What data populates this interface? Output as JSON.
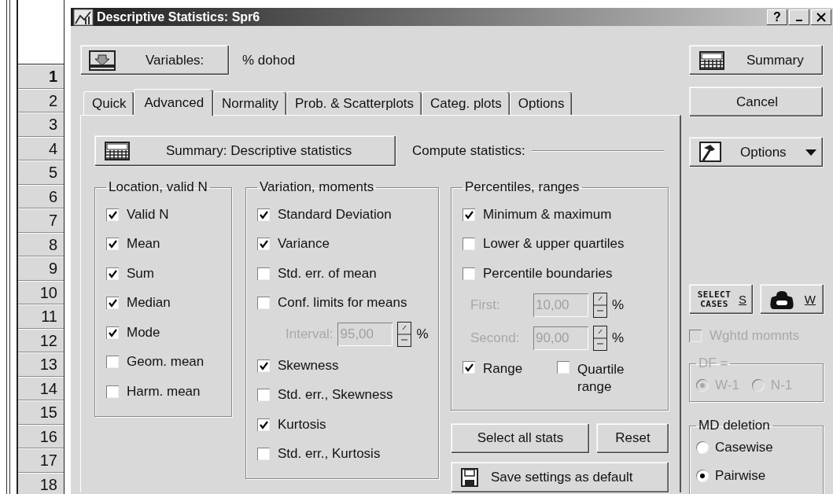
{
  "spreadsheet": {
    "row_headers": [
      {
        "label": "1",
        "selected": true
      },
      {
        "label": "2",
        "selected": false
      },
      {
        "label": "3",
        "selected": false
      },
      {
        "label": "4",
        "selected": false
      },
      {
        "label": "5",
        "selected": false
      },
      {
        "label": "6",
        "selected": false
      },
      {
        "label": "7",
        "selected": false
      },
      {
        "label": "8",
        "selected": false
      },
      {
        "label": "9",
        "selected": false
      },
      {
        "label": "10",
        "selected": false
      },
      {
        "label": "11",
        "selected": false
      },
      {
        "label": "12",
        "selected": false
      },
      {
        "label": "13",
        "selected": false
      },
      {
        "label": "14",
        "selected": false
      },
      {
        "label": "15",
        "selected": false
      },
      {
        "label": "16",
        "selected": false
      },
      {
        "label": "17",
        "selected": false
      },
      {
        "label": "18",
        "selected": false
      }
    ]
  },
  "window": {
    "title": "Descriptive Statistics: Spr6",
    "help_button": "?"
  },
  "variables": {
    "button": "Variables:",
    "value": "% dohod"
  },
  "tabs": [
    {
      "label": "Quick",
      "selected": false
    },
    {
      "label": "Advanced",
      "selected": true
    },
    {
      "label": "Normality",
      "selected": false
    },
    {
      "label": "Prob. & Scatterplots",
      "selected": false
    },
    {
      "label": "Categ. plots",
      "selected": false
    },
    {
      "label": "Options",
      "selected": false
    }
  ],
  "panel": {
    "summary_button": "Summary: Descriptive statistics",
    "compute_label": "Compute statistics:",
    "groups": [
      {
        "title": "Location, valid N",
        "items": [
          {
            "kind": "checkbox",
            "label": "Valid N",
            "checked": true
          },
          {
            "kind": "checkbox",
            "label": "Mean",
            "checked": true
          },
          {
            "kind": "checkbox",
            "label": "Sum",
            "checked": true
          },
          {
            "kind": "checkbox",
            "label": "Median",
            "checked": true
          },
          {
            "kind": "checkbox",
            "label": "Mode",
            "checked": true
          },
          {
            "kind": "checkbox",
            "label": "Geom. mean",
            "checked": false
          },
          {
            "kind": "checkbox",
            "label": "Harm. mean",
            "checked": false
          }
        ]
      },
      {
        "title": "Variation, moments",
        "items": [
          {
            "kind": "checkbox",
            "label": "Standard Deviation",
            "checked": true
          },
          {
            "kind": "checkbox",
            "label": "Variance",
            "checked": true
          },
          {
            "kind": "checkbox",
            "label": "Std. err. of mean",
            "checked": false
          },
          {
            "kind": "checkbox",
            "label": "Conf. limits for means",
            "checked": false
          },
          {
            "kind": "spin",
            "label": "Interval:",
            "value": "95,00",
            "unit": "%",
            "disabled": true
          },
          {
            "kind": "checkbox",
            "label": "Skewness",
            "checked": true
          },
          {
            "kind": "checkbox",
            "label": "Std. err., Skewness",
            "checked": false
          },
          {
            "kind": "checkbox",
            "label": "Kurtosis",
            "checked": true
          },
          {
            "kind": "checkbox",
            "label": "Std. err., Kurtosis",
            "checked": false
          }
        ]
      },
      {
        "title": "Percentiles, ranges",
        "items": [
          {
            "kind": "checkbox",
            "label": "Minimum & maximum",
            "checked": true
          },
          {
            "kind": "checkbox",
            "label": "Lower & upper quartiles",
            "checked": false
          },
          {
            "kind": "checkbox",
            "label": "Percentile boundaries",
            "checked": false
          },
          {
            "kind": "spin",
            "label": "First:",
            "value": "10,00",
            "unit": "%",
            "disabled": true
          },
          {
            "kind": "spin",
            "label": "Second:",
            "value": "90,00",
            "unit": "%",
            "disabled": true
          },
          {
            "kind": "pair",
            "items": [
              {
                "label": "Range",
                "checked": true
              },
              {
                "label": "Quartile range",
                "checked": false
              }
            ]
          }
        ]
      }
    ],
    "buttons": [
      "Select all stats",
      "Reset",
      "Save settings as default"
    ]
  },
  "side": {
    "summary": "Summary",
    "cancel": "Cancel",
    "options": "Options",
    "select_cases": {
      "label": "SELECT CASES",
      "key": "S"
    },
    "weight": {
      "key": "W"
    },
    "weighted_moments": {
      "label": "Wghtd momnts",
      "checked": false,
      "disabled": true
    },
    "df": {
      "title": "DF =",
      "disabled": true,
      "options": [
        {
          "label": "W-1",
          "selected": true
        },
        {
          "label": "N-1",
          "selected": false
        }
      ]
    },
    "md_deletion": {
      "title": "MD deletion",
      "options": [
        {
          "label": "Casewise",
          "selected": false
        },
        {
          "label": "Pairwise",
          "selected": true
        }
      ]
    }
  }
}
